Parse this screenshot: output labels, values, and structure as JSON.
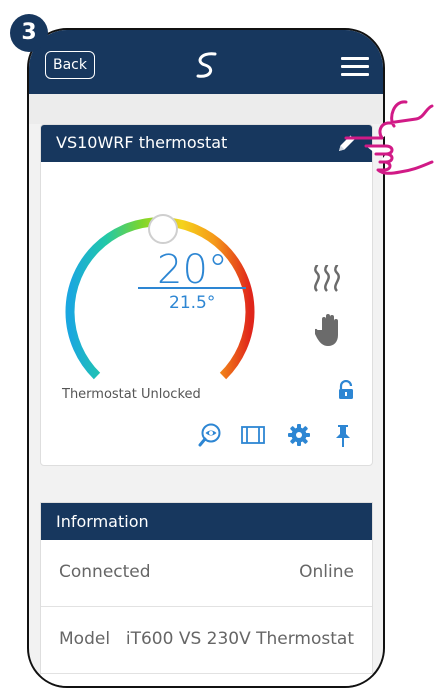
{
  "step_badge": "3",
  "topbar": {
    "back_label": "Back"
  },
  "device": {
    "title": "VS10WRF thermostat",
    "setpoint": "20°",
    "current_temp": "21.5°",
    "status": "Thermostat Unlocked",
    "dial_colors": [
      "#1aa7e0",
      "#22c8a8",
      "#7dd62a",
      "#f5d31c",
      "#f59a1a",
      "#e0261b"
    ]
  },
  "information": {
    "title": "Information",
    "rows": [
      {
        "label": "Connected",
        "value": "Online"
      },
      {
        "label": "Model",
        "value": "iT600 VS 230V Thermostat"
      }
    ]
  },
  "colors": {
    "header": "#17375e",
    "accent": "#2d86d3",
    "pointer": "#d11a86"
  }
}
